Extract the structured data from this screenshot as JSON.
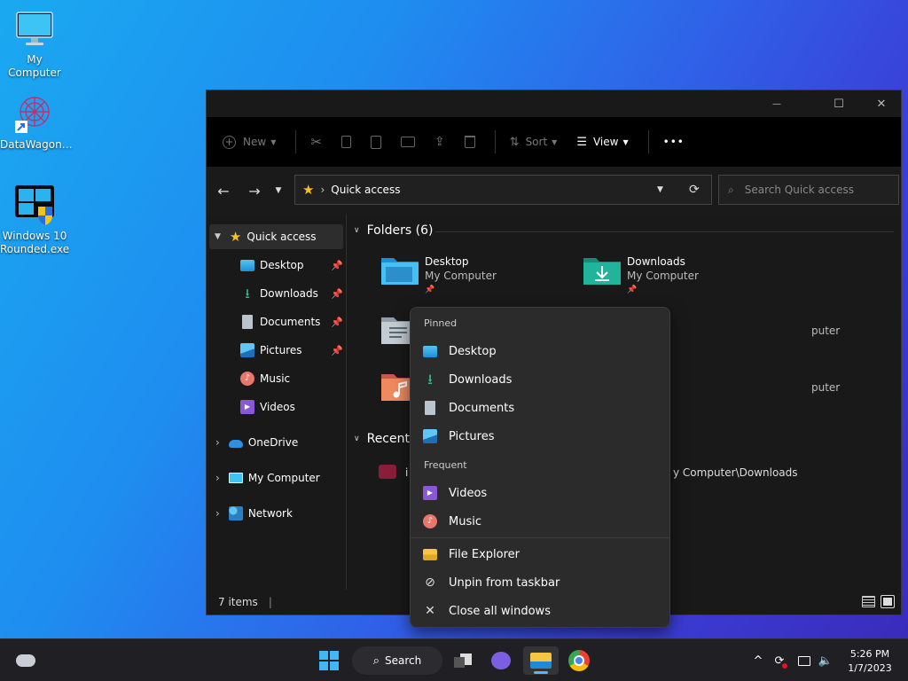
{
  "desktop": {
    "icons": [
      {
        "label": "My Computer",
        "icon": "monitor-icon"
      },
      {
        "label": "DataWagon…",
        "icon": "datawagon-shortcut-icon"
      },
      {
        "label": "Windows 10 Rounded.exe",
        "icon": "windows-exe-icon"
      }
    ]
  },
  "explorer": {
    "caption": {
      "minimize": "—",
      "maximize": "☐",
      "close": "✕"
    },
    "toolbar": {
      "new": "New",
      "sort": "Sort",
      "view": "View",
      "more": "•••"
    },
    "address": {
      "location": "Quick access"
    },
    "search": {
      "placeholder": "Search Quick access"
    },
    "sidebar": {
      "quick_access": "Quick access",
      "pinned": [
        {
          "label": "Desktop",
          "icon": "desktop-folder-icon",
          "pinned": true
        },
        {
          "label": "Downloads",
          "icon": "download-icon",
          "pinned": true
        },
        {
          "label": "Documents",
          "icon": "document-icon",
          "pinned": true
        },
        {
          "label": "Pictures",
          "icon": "pictures-icon",
          "pinned": true
        },
        {
          "label": "Music",
          "icon": "music-icon",
          "pinned": false
        },
        {
          "label": "Videos",
          "icon": "videos-icon",
          "pinned": false
        }
      ],
      "roots": [
        {
          "label": "OneDrive",
          "icon": "onedrive-icon"
        },
        {
          "label": "My Computer",
          "icon": "computer-icon"
        },
        {
          "label": "Network",
          "icon": "network-icon"
        }
      ]
    },
    "content": {
      "folders_header": "Folders (6)",
      "folders": [
        {
          "name": "Desktop",
          "location": "My Computer",
          "pin": "📌"
        },
        {
          "name": "Downloads",
          "location": "My Computer",
          "pin": "📌"
        },
        {
          "visible_location": "puter"
        },
        {
          "visible_location": "puter"
        }
      ],
      "recent_header": "Recent",
      "recent_item": {
        "name": "i",
        "path": "y Computer\\Downloads"
      }
    },
    "status": {
      "items": "7 items",
      "divider": "|"
    }
  },
  "jumplist": {
    "pinned_header": "Pinned",
    "pinned": [
      {
        "label": "Desktop",
        "icon": "desktop-folder-icon"
      },
      {
        "label": "Downloads",
        "icon": "download-icon"
      },
      {
        "label": "Documents",
        "icon": "document-icon"
      },
      {
        "label": "Pictures",
        "icon": "pictures-icon"
      }
    ],
    "frequent_header": "Frequent",
    "frequent": [
      {
        "label": "Videos",
        "icon": "videos-icon"
      },
      {
        "label": "Music",
        "icon": "music-icon"
      }
    ],
    "actions": [
      {
        "label": "File Explorer",
        "icon": "file-explorer-icon"
      },
      {
        "label": "Unpin from taskbar",
        "icon": "unpin-icon"
      },
      {
        "label": "Close all windows",
        "icon": "close-icon"
      }
    ]
  },
  "taskbar": {
    "search_label": "Search",
    "time": "5:26 PM",
    "date": "1/7/2023",
    "tray_chevron": "^"
  },
  "colors": {
    "folder_blue": "#2aa0e8",
    "folder_teal": "#1fa38f",
    "star": "#f4c21b",
    "accent": "#0078d4"
  }
}
